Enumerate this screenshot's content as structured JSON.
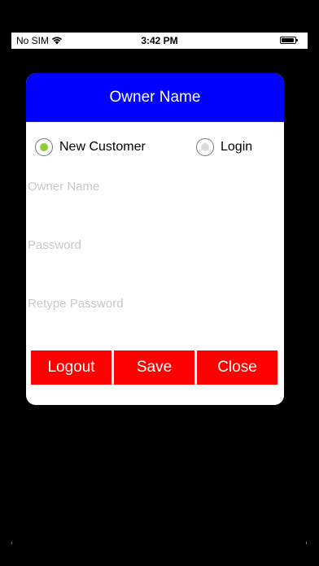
{
  "status_bar": {
    "carrier": "No SIM",
    "time": "3:42 PM"
  },
  "dialog": {
    "title": "Owner Name",
    "radio_options": [
      {
        "label": "New Customer",
        "selected": true
      },
      {
        "label": "Login",
        "selected": false
      }
    ],
    "fields": [
      {
        "placeholder": "Owner Name",
        "value": ""
      },
      {
        "placeholder": "Password",
        "value": ""
      },
      {
        "placeholder": "Retype Password",
        "value": ""
      }
    ],
    "buttons": {
      "logout": "Logout",
      "save": "Save",
      "close": "Close"
    }
  },
  "colors": {
    "header_bg": "#0000ff",
    "button_bg": "#ff0000",
    "radio_selected": "#8fcc3a",
    "background": "#000000"
  }
}
